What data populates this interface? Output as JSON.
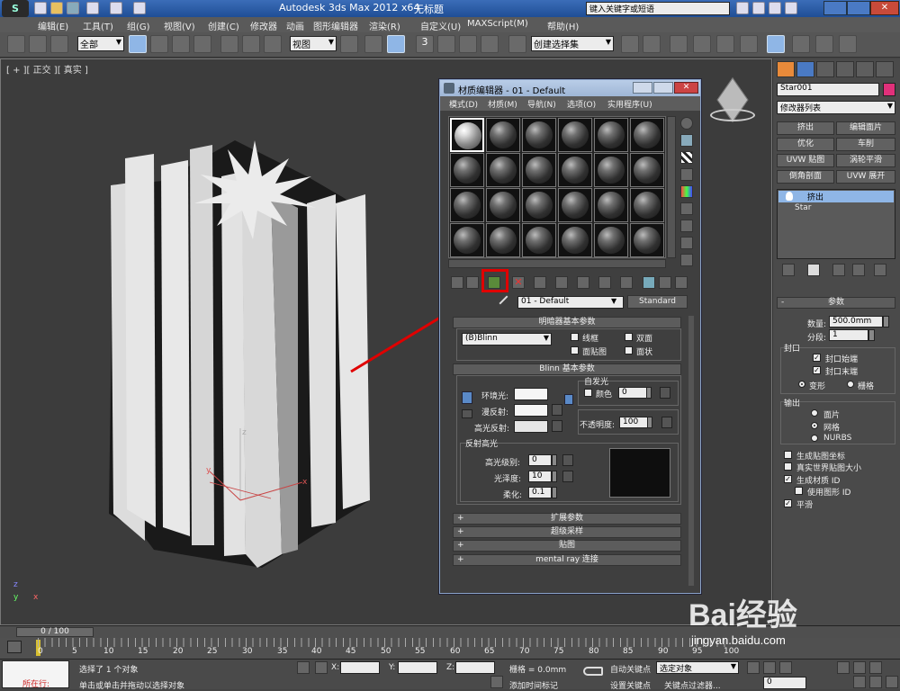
{
  "app": {
    "title": "Autodesk 3ds Max  2012 x64",
    "file": "无标题",
    "search_placeholder": "键入关键字或短语"
  },
  "menu": [
    "编辑(E)",
    "工具(T)",
    "组(G)",
    "视图(V)",
    "创建(C)",
    "修改器",
    "动画",
    "图形编辑器",
    "渲染(R)",
    "自定义(U)",
    "MAXScript(M)",
    "帮助(H)"
  ],
  "toolbar": {
    "selection_filter": "全部",
    "ref_coord": "视图",
    "snap_label": "3",
    "named_selection": "创建选择集"
  },
  "viewport": {
    "label": "[ + ][ 正交 ][ 真实 ]",
    "gizmo_y": "y",
    "gizmo_x": "x",
    "gizmo_z": "z",
    "corner_x": "x",
    "corner_z": "z",
    "corner_y": "y"
  },
  "material_editor": {
    "title": "材质编辑器 - 01 - Default",
    "menu": [
      "模式(D)",
      "材质(M)",
      "导航(N)",
      "选项(O)",
      "实用程序(U)"
    ],
    "material_name": "01 - Default",
    "material_type": "Standard",
    "shader_rollout": "明暗器基本参数",
    "shader": "(B)Blinn",
    "wire": "线框",
    "two_sided": "双面",
    "face_map": "面贴图",
    "faceted": "面状",
    "blinn_rollout": "Blinn 基本参数",
    "self_illum": "自发光",
    "color": "颜色",
    "self_illum_value": "0",
    "ambient": "环境光:",
    "diffuse": "漫反射:",
    "specular": "高光反射:",
    "opacity": "不透明度:",
    "opacity_value": "100",
    "spec_highlights": "反射高光",
    "spec_level": "高光级别:",
    "spec_level_value": "0",
    "glossiness": "光泽度:",
    "glossiness_value": "10",
    "soften": "柔化:",
    "soften_value": "0.1",
    "rollouts": [
      "扩展参数",
      "超级采样",
      "贴图",
      "mental ray 连接"
    ]
  },
  "command_panel": {
    "object_name": "Star001",
    "modifier_list": "修改器列表",
    "buttons": [
      "挤出",
      "编辑面片",
      "优化",
      "车削",
      "UVW 贴图",
      "涡轮平滑",
      "倒角剖面",
      "UVW 展开"
    ],
    "stack": [
      "挤出",
      "Star"
    ],
    "params_title": "参数",
    "amount_label": "数量:",
    "amount_value": "500.0mm",
    "segments_label": "分段:",
    "segments_value": "1",
    "capping": "封口",
    "cap_start": "封口始端",
    "cap_end": "封口末端",
    "morph": "变形",
    "grid": "栅格",
    "output": "输出",
    "patch": "面片",
    "mesh": "网格",
    "nurbs": "NURBS",
    "gen_map_coords": "生成贴图坐标",
    "real_world": "真实世界贴图大小",
    "gen_mat_ids": "生成材质 ID",
    "use_shape_ids": "使用图形 ID",
    "smooth": "平滑"
  },
  "timeline": {
    "frame": "0 / 100",
    "ticks": [
      "0",
      "5",
      "10",
      "15",
      "20",
      "25",
      "30",
      "35",
      "40",
      "45",
      "50",
      "55",
      "60",
      "65",
      "70",
      "75",
      "80",
      "85",
      "90",
      "95",
      "100"
    ]
  },
  "status": {
    "selected": "选择了 1 个对象",
    "prompt": "单击或单击并拖动以选择对象",
    "running": "所在行:",
    "x_label": "X:",
    "y_label": "Y:",
    "z_label": "Z:",
    "grid": "栅格 = 0.0mm",
    "auto_key": "自动关键点",
    "selected_set": "选定对象",
    "set_key": "设置关键点",
    "key_filters": "关键点过滤器...",
    "add_time_tag": "添加时间标记",
    "frame_value": "0"
  },
  "watermark": {
    "logo": "Bai经验",
    "url": "jingyan.baidu.com"
  },
  "colors": {
    "highlight_box": "#e00000",
    "arrow": "#e00000",
    "object_color": "#e0307a"
  }
}
